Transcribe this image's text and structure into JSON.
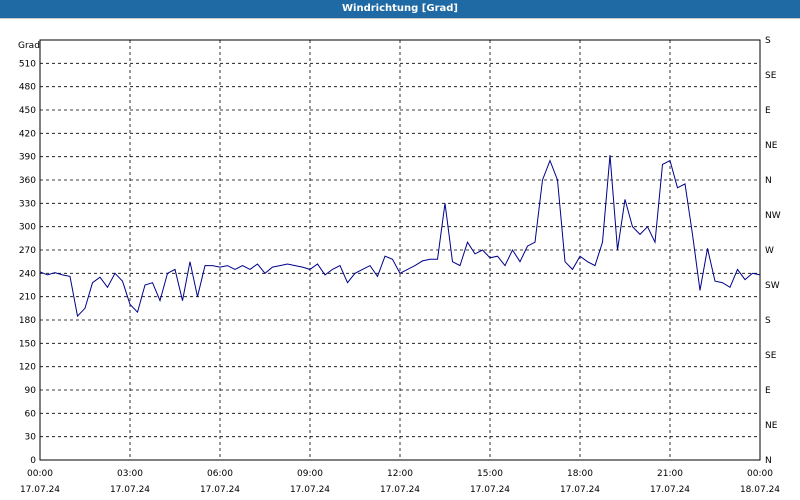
{
  "window": {
    "title": "Windrichtung [Grad]"
  },
  "chart_data": {
    "type": "line",
    "title": "Windrichtung [Grad]",
    "ylabel": "Grad",
    "ylim": [
      0,
      540
    ],
    "yticks": [
      0,
      30,
      60,
      90,
      120,
      150,
      180,
      210,
      240,
      270,
      300,
      330,
      360,
      390,
      420,
      450,
      480,
      510
    ],
    "right_axis_labels": [
      "N",
      "NE",
      "E",
      "SE",
      "S",
      "SW",
      "W",
      "NW",
      "N",
      "NE",
      "E",
      "SE",
      "S"
    ],
    "x_ticks": [
      {
        "time": "00:00",
        "date": "17.07.24"
      },
      {
        "time": "03:00",
        "date": "17.07.24"
      },
      {
        "time": "06:00",
        "date": "17.07.24"
      },
      {
        "time": "09:00",
        "date": "17.07.24"
      },
      {
        "time": "12:00",
        "date": "17.07.24"
      },
      {
        "time": "15:00",
        "date": "17.07.24"
      },
      {
        "time": "18:00",
        "date": "17.07.24"
      },
      {
        "time": "21:00",
        "date": "17.07.24"
      },
      {
        "time": "00:00",
        "date": "18.07.24"
      }
    ],
    "grid": true,
    "line_color": "#00008b",
    "series": [
      {
        "x_hours": [
          0,
          0.25,
          0.5,
          0.75,
          1,
          1.25,
          1.5,
          1.75,
          2,
          2.25,
          2.5,
          2.75,
          3,
          3.25,
          3.5,
          3.75,
          4,
          4.25,
          4.5,
          4.75,
          5,
          5.25,
          5.5,
          5.75,
          6,
          6.25,
          6.5,
          6.75,
          7,
          7.25,
          7.5,
          7.75,
          8,
          8.25,
          8.5,
          8.75,
          9,
          9.25,
          9.5,
          9.75,
          10,
          10.25,
          10.5,
          10.75,
          11,
          11.25,
          11.5,
          11.75,
          12,
          12.25,
          12.5,
          12.75,
          13,
          13.25,
          13.5,
          13.75,
          14,
          14.25,
          14.5,
          14.75,
          15,
          15.25,
          15.5,
          15.75,
          16,
          16.25,
          16.5,
          16.75,
          17,
          17.25,
          17.5,
          17.75,
          18,
          18.25,
          18.5,
          18.75,
          19,
          19.25,
          19.5,
          19.75,
          20,
          20.25,
          20.5,
          20.75,
          21,
          21.25,
          21.5,
          21.75,
          22,
          22.25,
          22.5,
          22.75,
          23,
          23.25,
          23.5,
          23.75,
          24
        ],
        "values": [
          242,
          238,
          241,
          238,
          236,
          185,
          195,
          228,
          235,
          222,
          240,
          230,
          200,
          190,
          225,
          228,
          205,
          240,
          245,
          205,
          255,
          210,
          250,
          250,
          248,
          250,
          245,
          250,
          245,
          252,
          240,
          248,
          250,
          252,
          250,
          248,
          245,
          252,
          238,
          245,
          250,
          228,
          240,
          245,
          250,
          236,
          262,
          258,
          240,
          245,
          250,
          256,
          258,
          258,
          330,
          255,
          250,
          280,
          265,
          270,
          260,
          262,
          250,
          270,
          255,
          275,
          280,
          360,
          385,
          360,
          255,
          245,
          262,
          255,
          250,
          280,
          392,
          270,
          335,
          300,
          290,
          300,
          280,
          380,
          385,
          350,
          355,
          290,
          218,
          272,
          230,
          228,
          222,
          245,
          232,
          240,
          238,
          240,
          236,
          240,
          238,
          242,
          245,
          240,
          248,
          245,
          236
        ]
      }
    ]
  }
}
